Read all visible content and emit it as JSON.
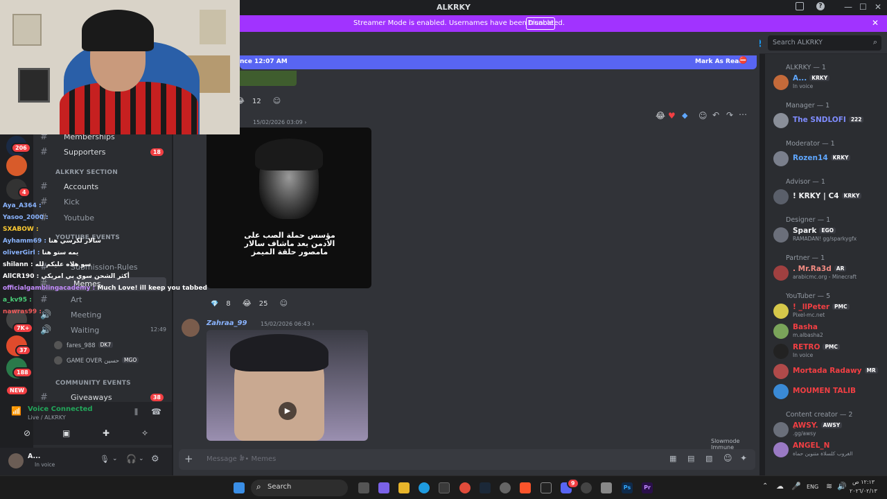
{
  "window": {
    "title": "ALKRKY",
    "min": "—",
    "max": "☐",
    "close": "✕"
  },
  "banner": {
    "text": "Streamer Mode is enabled. Usernames have been truncated.",
    "button": "Disable",
    "close": "✕"
  },
  "topbar": {
    "search_placeholder": "Search ALKRKY"
  },
  "new_messages": {
    "since": "nce 12:07 AM",
    "mark_read": "Mark As Read"
  },
  "servers": {
    "badges": [
      "206",
      "4",
      "7K+",
      "37",
      "188"
    ],
    "new_label": "NEW"
  },
  "channels": {
    "items": [
      {
        "name": "Memberships",
        "count": ""
      },
      {
        "name": "Supporters",
        "count": "18"
      },
      {
        "name": "Accounts",
        "count": ""
      },
      {
        "name": "Kick",
        "count": ""
      },
      {
        "name": "Youtube",
        "count": ""
      },
      {
        "name": "Submission-Rules",
        "count": ""
      },
      {
        "name": "Memes",
        "count": ""
      },
      {
        "name": "Art",
        "count": ""
      },
      {
        "name": "Meeting",
        "count": ""
      },
      {
        "name": "Waiting",
        "count": "12:49"
      },
      {
        "name": "Giveaways",
        "count": "38"
      }
    ],
    "categories": [
      "ALKRKY SECTION",
      "YOUTUBE EVENTS",
      "COMMUNITY EVENTS"
    ],
    "voice_users": [
      {
        "name": "fares_988",
        "tag": "DK7"
      },
      {
        "name": "GAME OVER حسين",
        "tag": "MGO"
      }
    ]
  },
  "overlay_chat": [
    {
      "user": "Aya_A364 :",
      "msg": ""
    },
    {
      "user": "Yasoo_2000 :",
      "msg": ""
    },
    {
      "user": "SXABOW :",
      "msg": ""
    },
    {
      "user": "Ayhamm69 :",
      "msg": "سالار لكرسي هنا"
    },
    {
      "user": "oliverGirl :",
      "msg": "يمه ستو هنا"
    },
    {
      "user": "shilann :",
      "msg": "سو هلاه عليكم لله"
    },
    {
      "user": "AllCR190 :",
      "msg": "أكثر الشحن سوي بي امريكي"
    },
    {
      "user": "officialgamblingacademy :",
      "msg": "Much Love! ill keep you tabbed"
    },
    {
      "user": "a_kv95 :",
      "msg": ""
    },
    {
      "user": "nawras99 :",
      "msg": ""
    }
  ],
  "voice": {
    "status": "Voice Connected",
    "channel": "Live / ALKRKY"
  },
  "user": {
    "name": "A...",
    "status": "In voice"
  },
  "messages": [
    {
      "reactions": [
        {
          "emoji": "😂",
          "count": "12"
        }
      ],
      "time": ""
    },
    {
      "author": "",
      "time": "15/02/2026 03:09 ›",
      "caption": "مؤسس حملة الصب على الادمن بعد ماشاف سالار مامصور حلقة الميمز",
      "reactions": [
        {
          "emoji": "💎",
          "count": "8"
        },
        {
          "emoji": "😂",
          "count": "25"
        }
      ]
    },
    {
      "author": "Zahraa_99",
      "time": "15/02/2026 06:43 ›",
      "caption": ""
    }
  ],
  "slowmode": "Slowmode Immune",
  "composer": {
    "placeholder": "Message #ٌ• Memes"
  },
  "members": {
    "groups": [
      {
        "title": "ALKRKY — 1",
        "members": [
          {
            "name": "A...",
            "tag": "KRKY",
            "sub": "In voice",
            "color": "#5fa7ff"
          }
        ]
      },
      {
        "title": "Manager — 1",
        "members": [
          {
            "name": "The SNDLOFI",
            "tag": "222",
            "sub": "",
            "color": "#7f8cff"
          }
        ]
      },
      {
        "title": "Moderator — 1",
        "members": [
          {
            "name": "Rozen14",
            "tag": "KRKY",
            "sub": "",
            "color": "#5fa7ff"
          }
        ]
      },
      {
        "title": "Advisor — 1",
        "members": [
          {
            "name": "! KRKY | C4",
            "tag": "KRKY",
            "sub": "",
            "color": "#f2f3f5"
          }
        ]
      },
      {
        "title": "Designer — 1",
        "members": [
          {
            "name": "Spark",
            "tag": "EGO",
            "sub": "RAMADAN! gg/sparkygfx",
            "color": "#f2f3f5"
          }
        ]
      },
      {
        "title": "Partner — 1",
        "members": [
          {
            "name": ". Mr.Ra3d",
            "tag": "AR",
            "sub": "arabicmc.org - Minecraft",
            "color": "#f28b82"
          }
        ]
      },
      {
        "title": "YouTuber — 5",
        "members": [
          {
            "name": "! _llPeter",
            "tag": "PMC",
            "sub": "Pixel-mc.net",
            "color": "#f23f43"
          },
          {
            "name": "Basha",
            "tag": "",
            "sub": "m.albasha2",
            "color": "#f23f43"
          },
          {
            "name": "RETRO",
            "tag": "PMC",
            "sub": "In voice",
            "color": "#f23f43"
          },
          {
            "name": "Mortada Radawy",
            "tag": "MR",
            "sub": "",
            "color": "#f23f43"
          },
          {
            "name": "MOUMEN TALIB",
            "tag": "",
            "sub": "",
            "color": "#f23f43"
          }
        ]
      },
      {
        "title": "Content creator — 2",
        "members": [
          {
            "name": "ِAWSY.",
            "tag": "AWSY",
            "sub": ".gg/awsy",
            "color": "#f23f43"
          },
          {
            "name": "ANGEL_N",
            "tag": "",
            "sub": "الغروب كلسلاة متنوين حماة",
            "color": "#f23f43"
          }
        ]
      }
    ]
  },
  "taskbar": {
    "search": "Search",
    "lang": "ENG",
    "time": "١٢:١٣ ص",
    "date": "٢٠٢٦/٠٢/١٣",
    "discord_badge": "9"
  },
  "colors": {
    "accent": "#5865f2",
    "banner": "#a133ff",
    "danger": "#f23f43",
    "bg": "#313338"
  }
}
